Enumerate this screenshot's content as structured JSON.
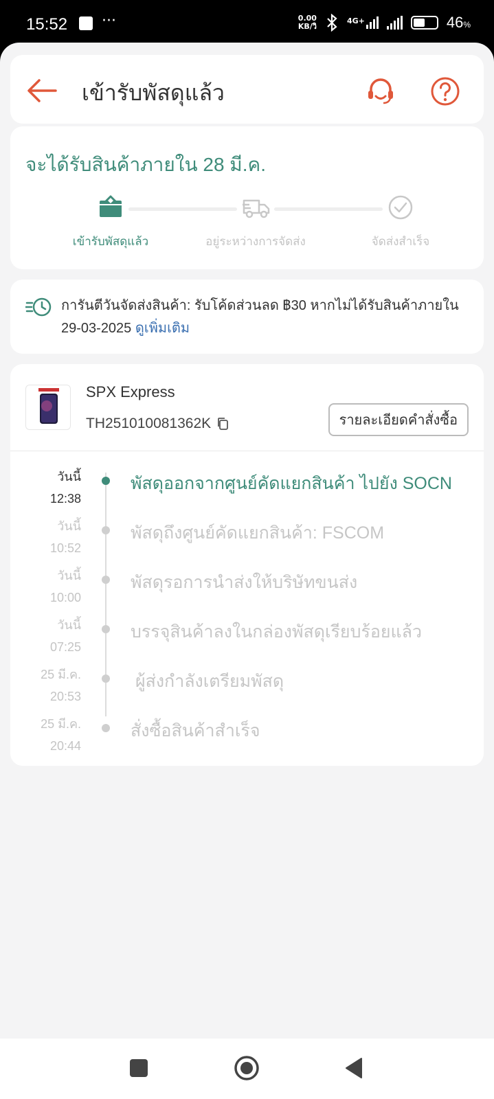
{
  "status_bar": {
    "time": "15:52",
    "dots": "···",
    "speed_value": "0.00",
    "speed_unit": "KB/วิ",
    "network": "4G+",
    "battery_pct": "46",
    "battery_unit": "%"
  },
  "header": {
    "title": "เข้ารับพัสดุแล้ว"
  },
  "delivery": {
    "eta": "จะได้รับสินค้าภายใน 28 มี.ค.",
    "steps": [
      {
        "label": "เข้ารับพัสดุแล้ว",
        "state": "done",
        "icon": "box-icon"
      },
      {
        "label": "อยู่ระหว่างการจัดส่ง",
        "state": "pending",
        "icon": "truck-icon"
      },
      {
        "label": "จัดส่งสำเร็จ",
        "state": "pending",
        "icon": "check-circle-icon"
      }
    ]
  },
  "guarantee": {
    "text": "การันตีวันจัดส่งสินค้า: รับโค้ดส่วนลด ฿30 หากไม่ได้รับสินค้าภายใน 29-03-2025",
    "link": "ดูเพิ่มเติม"
  },
  "tracking": {
    "carrier": "SPX Express",
    "tracking_no": "TH251010081362K",
    "order_button": "รายละเอียดคำสั่งซื้อ",
    "events": [
      {
        "day": "วันนี้",
        "time": "12:38",
        "desc": "พัสดุออกจากศูนย์คัดแยกสินค้า ไปยัง SOCN",
        "active": true
      },
      {
        "day": "วันนี้",
        "time": "10:52",
        "desc": "พัสดุถึงศูนย์คัดแยกสินค้า: FSCOM",
        "active": false
      },
      {
        "day": "วันนี้",
        "time": "10:00",
        "desc": "พัสดุรอการนำส่งให้บริษัทขนส่ง",
        "active": false
      },
      {
        "day": "วันนี้",
        "time": "07:25",
        "desc": "บรรจุสินค้าลงในกล่องพัสดุเรียบร้อยแล้ว",
        "active": false
      },
      {
        "day": "25 มี.ค.",
        "time": "20:53",
        "desc": " ผู้ส่งกำลังเตรียมพัสดุ",
        "active": false
      },
      {
        "day": "25 มี.ค.",
        "time": "20:44",
        "desc": "สั่งซื้อสินค้าสำเร็จ",
        "active": false
      }
    ]
  },
  "colors": {
    "accent": "#e0583a",
    "success": "#3f8c7a",
    "link": "#3a6fb0"
  }
}
